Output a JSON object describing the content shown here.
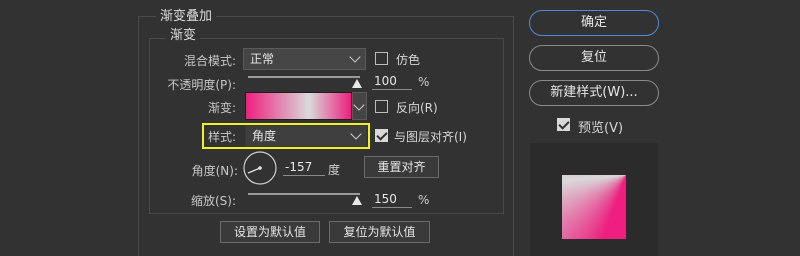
{
  "panel": {
    "title": "渐变叠加",
    "group_title": "渐变"
  },
  "blend_mode": {
    "label": "混合模式:",
    "value": "正常"
  },
  "dither": {
    "label": "仿色",
    "checked": false
  },
  "opacity": {
    "label": "不透明度(P):",
    "value": "100",
    "unit": "%",
    "fraction": 1.0
  },
  "gradient": {
    "label": "渐变:",
    "colors": [
      "#ee1f7f",
      "#d9d9d9",
      "#ee1f7f"
    ]
  },
  "reverse": {
    "label": "反向(R)",
    "checked": false
  },
  "style": {
    "label": "样式:",
    "value": "角度"
  },
  "align_layer": {
    "label": "与图层对齐(I)",
    "checked": true
  },
  "angle": {
    "label": "角度(N):",
    "value": "-157",
    "unit": "度",
    "dial_icon": "angle-dial-icon"
  },
  "reset_align_button": "重置对齐",
  "scale": {
    "label": "缩放(S):",
    "value": "150",
    "unit": "%",
    "fraction": 1.0
  },
  "bottom_buttons": {
    "set_default": "设置为默认值",
    "reset_default": "复位为默认值"
  },
  "side_buttons": {
    "ok": "确定",
    "reset": "复位",
    "new_style": "新建样式(W)..."
  },
  "preview": {
    "label": "预览(V)",
    "checked": true
  },
  "colors": {
    "accent": "#4e8ad8",
    "highlight": "#f4ee2a",
    "pink": "#ee1f7f"
  }
}
